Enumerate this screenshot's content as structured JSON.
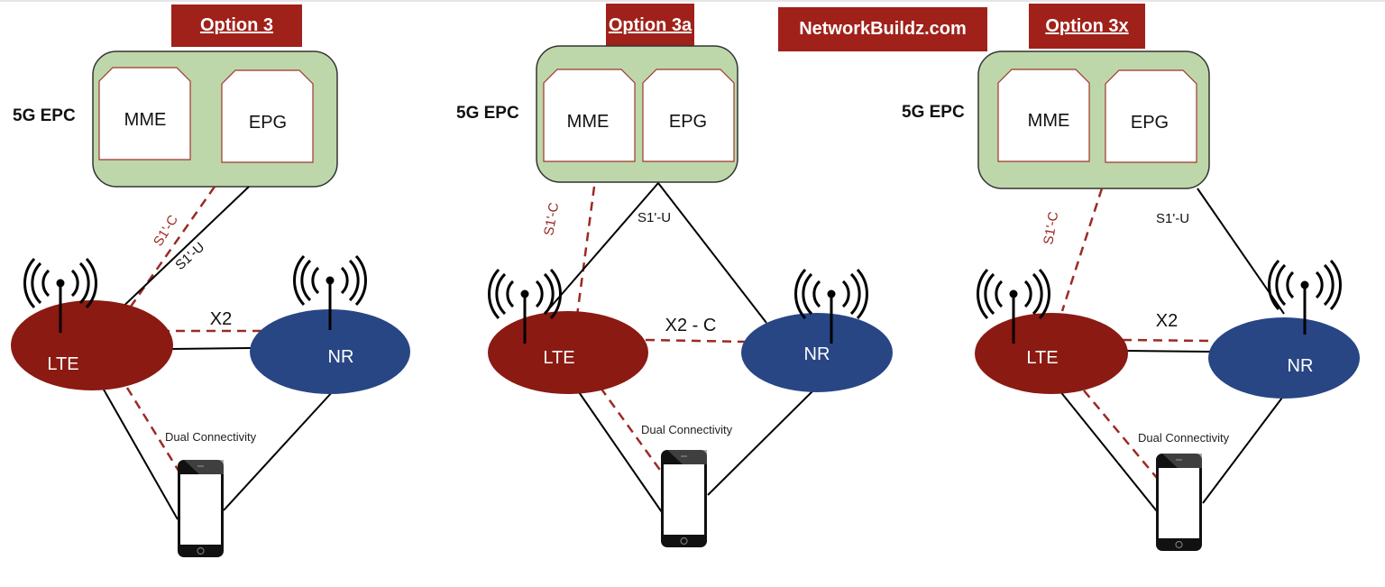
{
  "watermark": "NetworkBuildz.com",
  "colors": {
    "title_bg": "#a0211a",
    "core_fill": "#bdd7aa",
    "lte": "#8b1a12",
    "nr": "#284684",
    "control_line": "#9b2a24",
    "user_line": "#000000"
  },
  "panels": [
    {
      "title": "Option 3",
      "core_label": "5G EPC",
      "core_nodes": [
        "MME",
        "EPG"
      ],
      "lte_label": "LTE",
      "nr_label": "NR",
      "s1c_label": "S1'-C",
      "s1u_label": "S1'-U",
      "x2_label": "X2",
      "dc_label": "Dual Connectivity"
    },
    {
      "title": "Option 3a",
      "core_label": "5G EPC",
      "core_nodes": [
        "MME",
        "EPG"
      ],
      "lte_label": "LTE",
      "nr_label": "NR",
      "s1c_label": "S1'-C",
      "s1u_label": "S1'-U",
      "x2_label": "X2 - C",
      "dc_label": "Dual Connectivity"
    },
    {
      "title": "Option 3x",
      "core_label": "5G EPC",
      "core_nodes": [
        "MME",
        "EPG"
      ],
      "lte_label": "LTE",
      "nr_label": "NR",
      "s1c_label": "S1'-C",
      "s1u_label": "S1'-U",
      "x2_label": "X2",
      "dc_label": "Dual Connectivity"
    }
  ]
}
